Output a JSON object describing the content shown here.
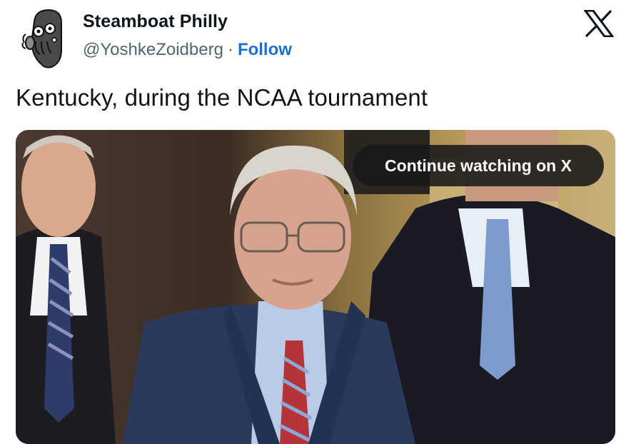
{
  "author": {
    "display_name": "Steamboat Philly",
    "handle": "@YoshkeZoidberg",
    "separator": "·",
    "follow_label": "Follow",
    "avatar_icon": "zoidberg-avatar-icon"
  },
  "brand": {
    "logo_icon": "x-logo-icon"
  },
  "tweet": {
    "text": "Kentucky, during the NCAA tournament"
  },
  "media": {
    "type": "video",
    "overlay_label": "Continue watching on X"
  },
  "colors": {
    "follow": "#1d6fc9",
    "handle": "#536471",
    "text": "#0f1419",
    "pill_bg": "#191919"
  }
}
